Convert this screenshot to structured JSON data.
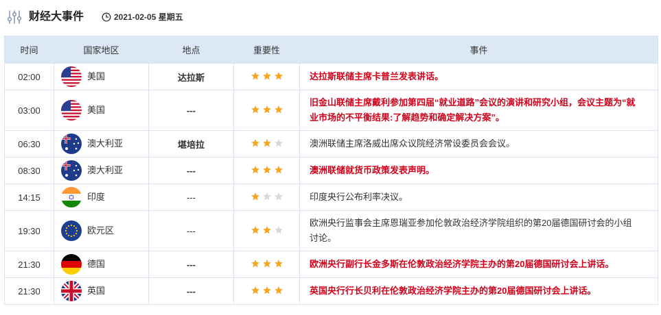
{
  "header": {
    "title": "财经大事件",
    "date": "2021-02-05 星期五"
  },
  "columns": [
    "时间",
    "国家地区",
    "地点",
    "重要性",
    "事件"
  ],
  "colors": {
    "accent_red": "#d0021b",
    "header_bg": "#dce8f5",
    "border": "#dbe3ec",
    "star_on": "#f5a623",
    "star_off": "#d8d8d8"
  },
  "events": [
    {
      "time": "02:00",
      "country": "美国",
      "flag": "us-flag-icon",
      "location": "达拉斯",
      "importance": 3,
      "event": "达拉斯联储主席卡普兰发表讲话。",
      "highlight": true
    },
    {
      "time": "03:00",
      "country": "美国",
      "flag": "us-flag-icon",
      "location": "---",
      "importance": 3,
      "event": "旧金山联储主席戴利参加第四届“就业道路”会议的演讲和研究小组，会议主题为“就业市场的不平衡结果:了解趋势和确定解决方案”。",
      "highlight": true
    },
    {
      "time": "06:30",
      "country": "澳大利亚",
      "flag": "au-flag-icon",
      "location": "堪培拉",
      "importance": 2,
      "event": "澳洲联储主席洛威出席众议院经济常设委员会会议。",
      "highlight": false
    },
    {
      "time": "08:30",
      "country": "澳大利亚",
      "flag": "au-flag-icon",
      "location": "---",
      "importance": 3,
      "event": "澳洲联储就货币政策发表声明。",
      "highlight": true
    },
    {
      "time": "14:15",
      "country": "印度",
      "flag": "in-flag-icon",
      "location": "---",
      "importance": 1,
      "event": "印度央行公布利率决议。",
      "highlight": false
    },
    {
      "time": "19:30",
      "country": "欧元区",
      "flag": "eu-flag-icon",
      "location": "---",
      "importance": 2,
      "event": "欧洲央行监事会主席恩瑞亚参加伦敦政治经济学院组织的第20届德国研讨会的小组讨论。",
      "highlight": false
    },
    {
      "time": "21:30",
      "country": "德国",
      "flag": "de-flag-icon",
      "location": "---",
      "importance": 3,
      "event": "欧洲央行副行长金多斯在伦敦政治经济学院主办的第20届德国研讨会上讲话。",
      "highlight": true
    },
    {
      "time": "21:30",
      "country": "英国",
      "flag": "gb-flag-icon",
      "location": "---",
      "importance": 3,
      "event": "英国央行行长贝利在伦敦政治经济学院主办的第20届德国研讨会上讲话。",
      "highlight": true
    }
  ]
}
